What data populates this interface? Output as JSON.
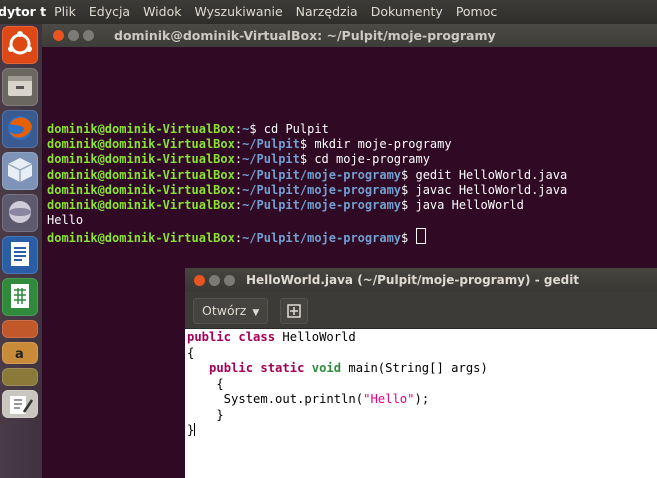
{
  "menubar": {
    "app_name": "dytor t",
    "items": [
      "Plik",
      "Edycja",
      "Widok",
      "Wyszukiwanie",
      "Narzędzia",
      "Dokumenty",
      "Pomoc"
    ]
  },
  "launcher": {
    "icons": [
      "ubuntu-dash-icon",
      "file-manager-icon",
      "firefox-icon",
      "software-center-icon",
      "system-settings-icon",
      "libreoffice-writer-icon",
      "libreoffice-calc-icon",
      "libreoffice-impress-icon",
      "amazon-icon",
      "gedit-icon"
    ]
  },
  "terminal": {
    "title": "dominik@dominik-VirtualBox: ~/Pulpit/moje-programy",
    "user_host": "dominik@dominik-VirtualBox",
    "lines": [
      {
        "path": "~",
        "command": "cd Pulpit"
      },
      {
        "path": "~/Pulpit",
        "command": "mkdir moje-programy"
      },
      {
        "path": "~/Pulpit",
        "command": "cd moje-programy"
      },
      {
        "path": "~/Pulpit/moje-programy",
        "command": "gedit HelloWorld.java"
      },
      {
        "path": "~/Pulpit/moje-programy",
        "command": "javac HelloWorld.java"
      },
      {
        "path": "~/Pulpit/moje-programy",
        "command": "java HelloWorld"
      }
    ],
    "output": "Hello",
    "final_prompt_path": "~/Pulpit/moje-programy"
  },
  "gedit": {
    "title": "HelloWorld.java (~/Pulpit/moje-programy) - gedit",
    "open_label": "Otwórz",
    "code": {
      "l1_kw": "public class",
      "l1_name": " HelloWorld",
      "l2": "{",
      "l3_indent": "   ",
      "l3_kw": "public static",
      "l3_type": " void",
      "l3_rest": " main(String[] args)",
      "l4": "    {",
      "l5_pre": "     System.out.println(",
      "l5_str": "\"Hello\"",
      "l5_post": ");",
      "l6": "    }",
      "l7": "}"
    }
  },
  "colors": {
    "terminal_bg": "#300a24",
    "prompt_user": "#8ae234",
    "prompt_path": "#729fcf",
    "close_button": "#e95420"
  }
}
